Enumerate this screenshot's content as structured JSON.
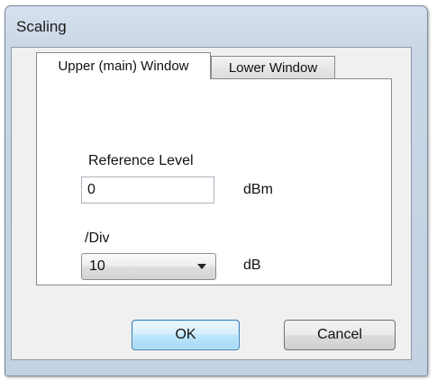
{
  "window": {
    "title": "Scaling"
  },
  "tabs": [
    {
      "label": "Upper (main) Window",
      "active": true
    },
    {
      "label": "Lower Window",
      "active": false
    }
  ],
  "reference": {
    "label": "Reference Level",
    "value": "0",
    "unit": "dBm"
  },
  "division": {
    "label": "/Div",
    "selected": "10",
    "unit": "dB"
  },
  "buttons": {
    "ok": "OK",
    "cancel": "Cancel"
  }
}
